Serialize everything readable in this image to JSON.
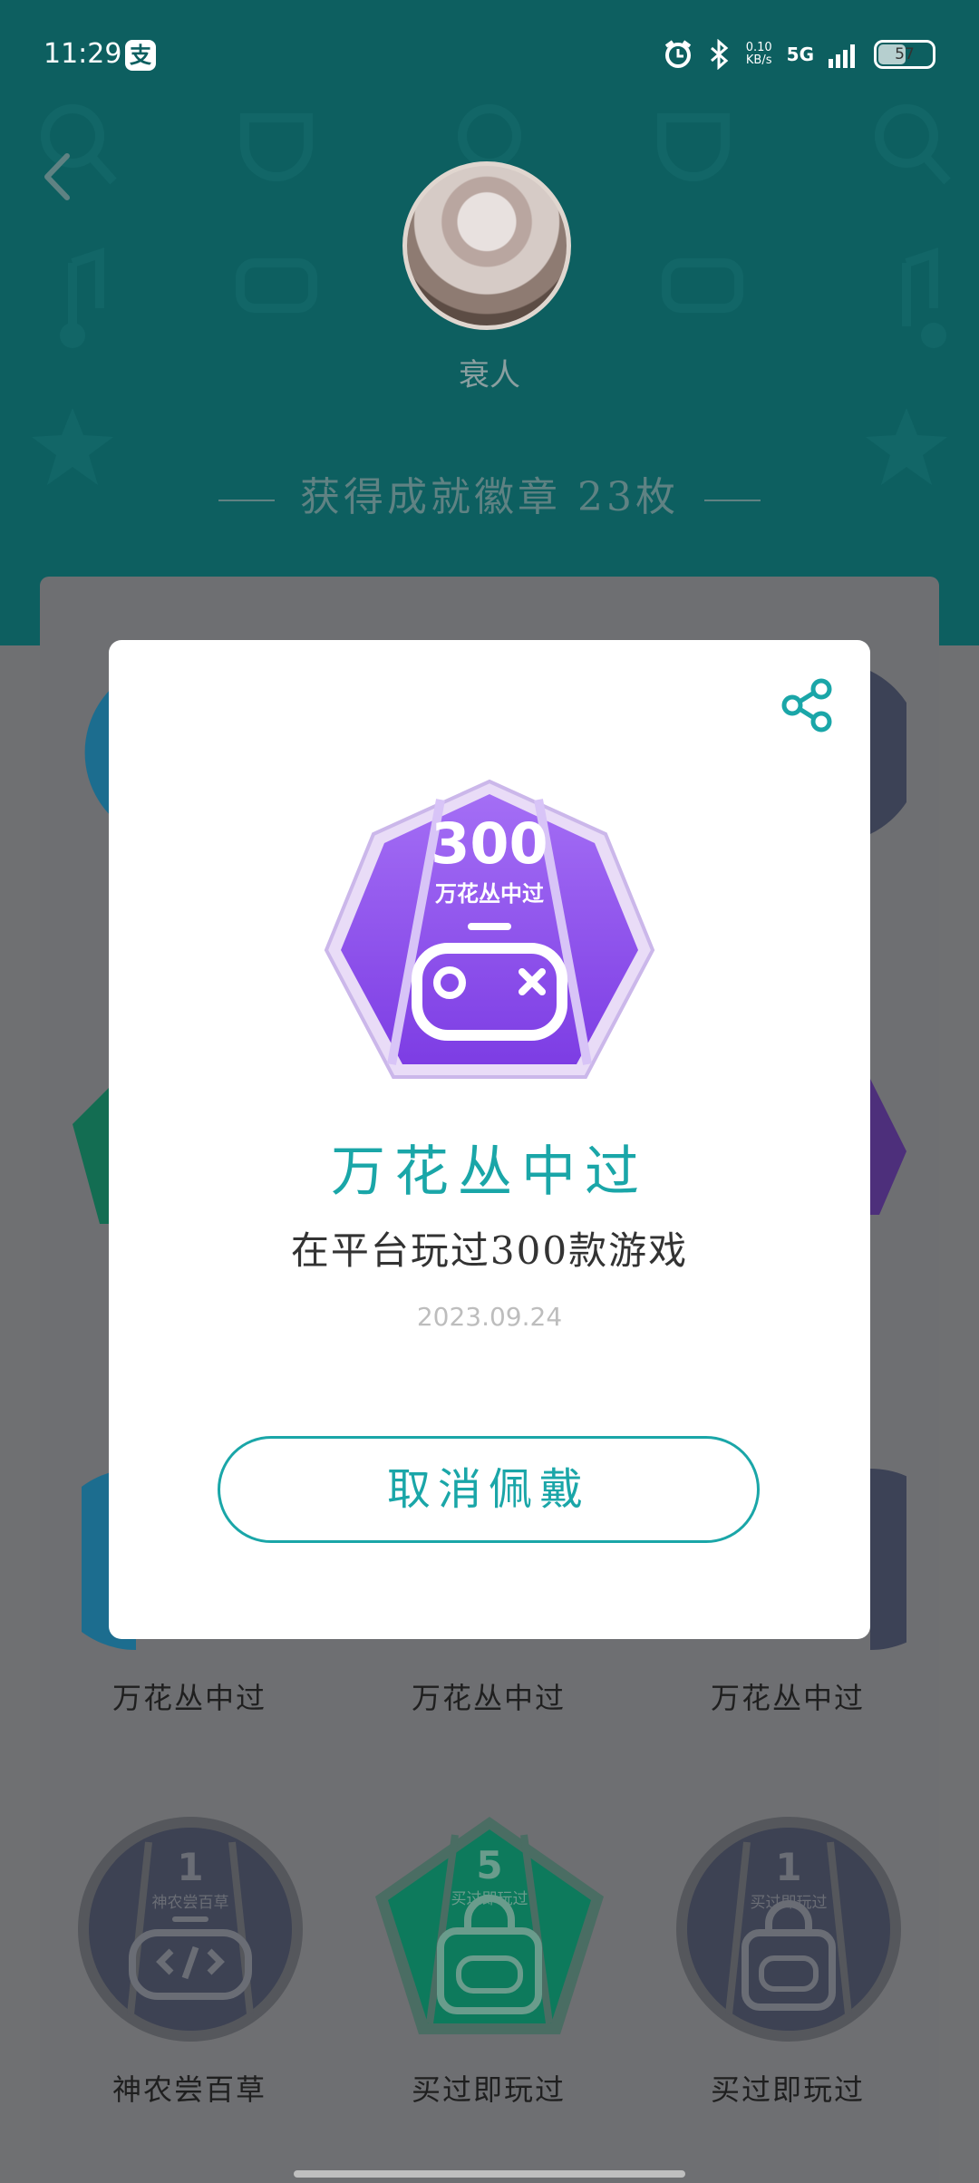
{
  "status_bar": {
    "time": "11:29",
    "app_icon_char": "支",
    "net_speed_value": "0.10",
    "net_speed_unit": "KB/s",
    "network": "5G",
    "battery": "57"
  },
  "profile": {
    "username": "衰人",
    "achievement_summary": "获得成就徽章 23枚"
  },
  "grid": {
    "row1_labels": [
      "万花丛中过",
      "万花丛中过",
      "万花丛中过"
    ],
    "row2": [
      {
        "label": "神农尝百草",
        "number": "1",
        "badge_text": "神农尝百草"
      },
      {
        "label": "买过即玩过",
        "number": "5",
        "badge_text": "买过即玩过"
      },
      {
        "label": "买过即玩过",
        "number": "1",
        "badge_text": "买过即玩过"
      }
    ]
  },
  "dialog": {
    "badge_number": "300",
    "badge_text": "万花丛中过",
    "title": "万花丛中过",
    "description": "在平台玩过300款游戏",
    "date": "2023.09.24",
    "cancel_label": "取消佩戴"
  },
  "colors": {
    "teal": "#1aa6a8",
    "header_bg": "#0d5f60",
    "badge_purple": "#8b4fe6"
  }
}
